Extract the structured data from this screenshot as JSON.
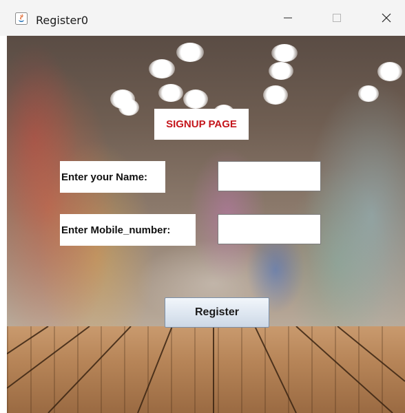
{
  "window": {
    "title": "Register0",
    "icons": {
      "app": "java-app-icon",
      "minimize": "minimize-icon",
      "maximize": "maximize-icon",
      "close": "close-icon"
    }
  },
  "form": {
    "heading": "SIGNUP PAGE",
    "name_label": "Enter your Name:",
    "name_value": "",
    "mobile_label": "Enter Mobile_number:",
    "mobile_value": "",
    "register_label": "Register"
  },
  "colors": {
    "heading": "#c4161c",
    "titlebar": "#f4f4f4"
  }
}
